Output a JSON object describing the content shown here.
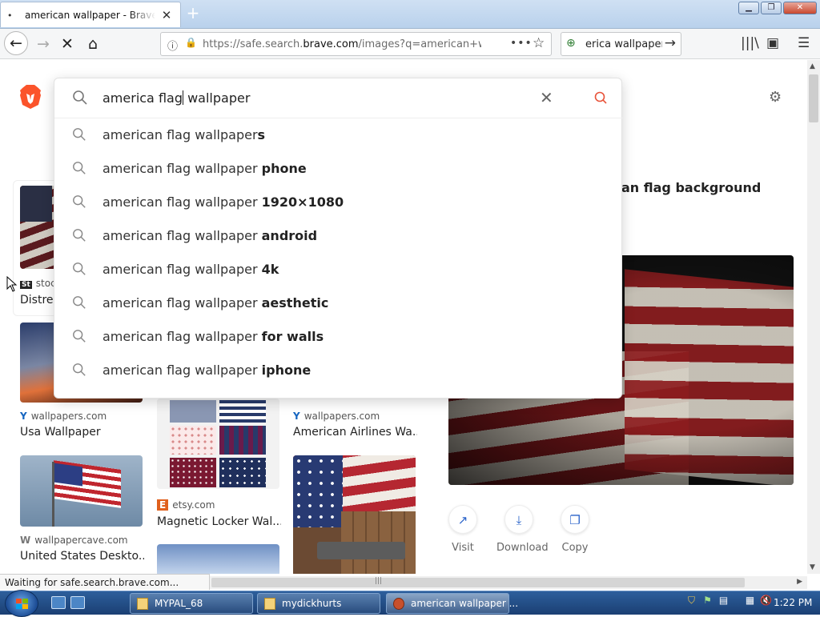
{
  "browser": {
    "tab_title": "american wallpaper - Brave Search",
    "url_prefix": "https://safe.search.",
    "url_domain": "brave.com",
    "url_rest": "/images?q=american+wallp",
    "search_box_value": "erica wallpaper",
    "status_text": "Waiting for safe.search.brave.com..."
  },
  "search": {
    "query_before_caret": "america flag",
    "query_after_caret": " wallpaper",
    "suggestions": [
      {
        "prefix": "american flag wallpaper",
        "suffix": "s"
      },
      {
        "prefix": "american flag wallpaper ",
        "suffix": "phone"
      },
      {
        "prefix": "american flag wallpaper ",
        "suffix": "1920×1080"
      },
      {
        "prefix": "american flag wallpaper ",
        "suffix": "android"
      },
      {
        "prefix": "american flag wallpaper ",
        "suffix": "4k"
      },
      {
        "prefix": "american flag wallpaper ",
        "suffix": "aesthetic"
      },
      {
        "prefix": "american flag wallpaper ",
        "suffix": "for walls"
      },
      {
        "prefix": "american flag wallpaper ",
        "suffix": "iphone"
      }
    ]
  },
  "results": {
    "heading_partial": "an flag background",
    "card1": {
      "source": "stoc",
      "caption": "Distres"
    },
    "card2": {
      "source": "wallpapers.com",
      "caption": "Usa Wallpaper"
    },
    "card3": {
      "source": "etsy.com",
      "caption": "Magnetic Locker Wal..."
    },
    "card4": {
      "source": "wallpapers.com",
      "caption": "American Airlines Wa..."
    },
    "card5": {
      "source": "wallpapercave.com",
      "caption": "United States Deskto..."
    }
  },
  "preview": {
    "actions": [
      "Visit",
      "Download",
      "Copy"
    ]
  },
  "taskbar": {
    "items": [
      "MYPAL_68",
      "mydickhurts",
      "american wallpaper ..."
    ],
    "clock": "1:22 PM"
  },
  "colors": {
    "brave_orange": "#fb542b",
    "flag_red": "#a81e2a",
    "flag_blue": "#1f2f5c",
    "link_blue": "#2a63c9"
  }
}
